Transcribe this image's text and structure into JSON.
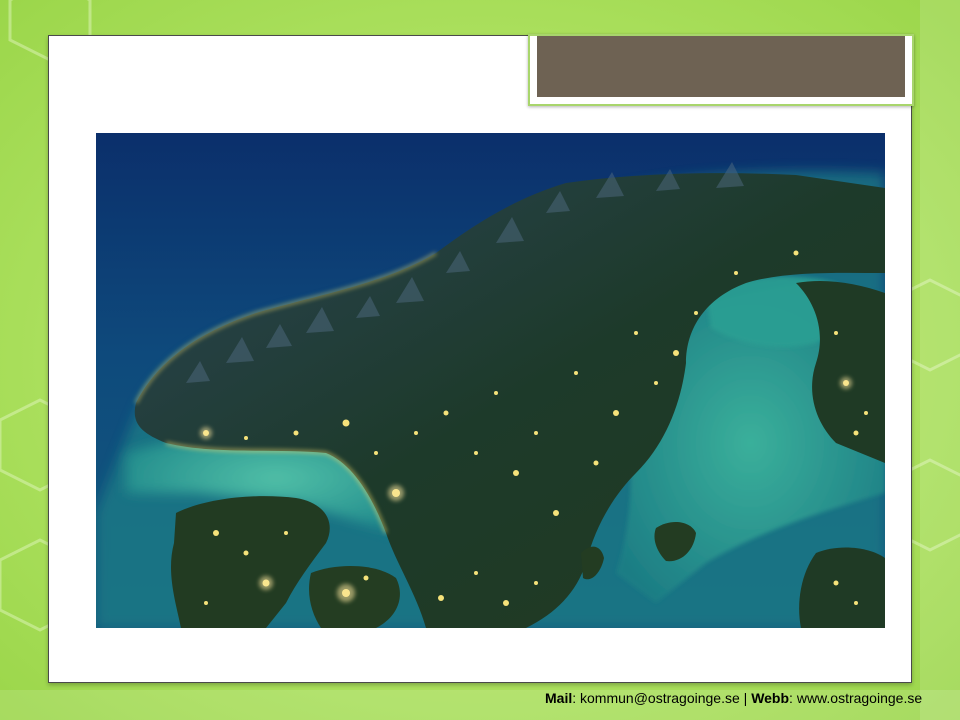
{
  "footer": {
    "mail_label": "Mail",
    "mail_sep": ": ",
    "mail_value": "kommun@ostragoinge.se",
    "divider": " | ",
    "web_label": "Webb",
    "web_sep": ": ",
    "web_value": "www.ostragoinge.se"
  },
  "colors": {
    "background": "#b2e466",
    "title_tab": "#6e6253",
    "tab_border": "#a8d56c",
    "sea_deep": "#0b2f6b",
    "sea_shallow": "#2fa88f",
    "land": "#1e3a2a",
    "city_lights": "#f5e27a"
  },
  "image": {
    "icon": "satellite-night-photo-icon"
  }
}
